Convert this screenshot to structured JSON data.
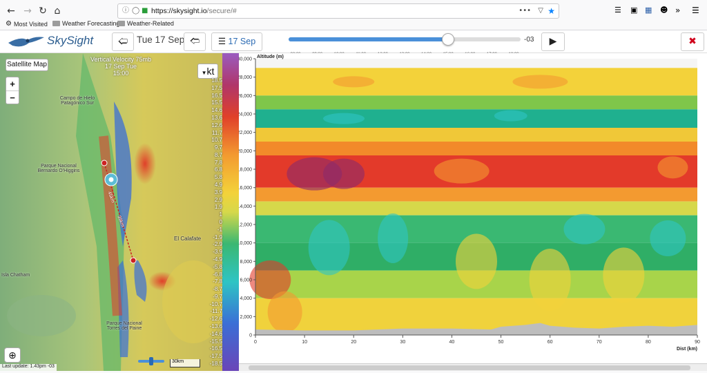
{
  "browser": {
    "url_host": "https://skysight.io",
    "url_path": "/secure/#",
    "bookmarks": [
      {
        "label": "Most Visited",
        "icon": "gear-icon"
      },
      {
        "label": "Weather Forecasting",
        "icon": "folder-icon"
      },
      {
        "label": "Weather-Related",
        "icon": "folder-icon"
      }
    ]
  },
  "app": {
    "logo_text": "SkySight",
    "date_label": "Tue 17 Sep",
    "calendar_label": "17 Sep",
    "timezone": "-03",
    "time_ticks": [
      "08:00",
      "09:00",
      "10:00",
      "11:00",
      "12:00",
      "13:00",
      "14:00",
      "15:00",
      "16:00",
      "17:00",
      "18:00"
    ],
    "selected_time_index": 7,
    "close_color": "#d0021b"
  },
  "map": {
    "satellite_button": "Satellite Map",
    "zoom_in": "+",
    "zoom_out": "−",
    "unit_button": "kt",
    "title_lines": [
      "Vertical Velocity 75mb",
      "17 Sep Tue",
      "15:00"
    ],
    "labels": [
      {
        "text": "Campo de Hielo Patagónico Sur"
      },
      {
        "text": "Parque Nacional Bernardo O'Higgins"
      },
      {
        "text": "El Calafate"
      },
      {
        "text": "Isla Chatham"
      },
      {
        "text": "Parque Nacional Torres del Paine"
      }
    ],
    "route_labels": [
      "45km",
      "39km"
    ],
    "scale_label": "30km",
    "last_update": "Last update: 1.43pm -03",
    "legend_values": [
      "18.5",
      "17.5",
      "16.5",
      "15.5",
      "14.6",
      "13.6",
      "12.6",
      "11.7",
      "10.7",
      "9.7",
      "8.7",
      "7.8",
      "6.8",
      "5.8",
      "4.9",
      "3.9",
      "2.9",
      "1.9",
      "1",
      "0",
      "-1",
      "-1.9",
      "-2.9",
      "-3.9",
      "-4.9",
      "-5.8",
      "-6.8",
      "-7.8",
      "-8.7",
      "-9.7",
      "-10.7",
      "-11.7",
      "-12.6",
      "-13.6",
      "-14.6",
      "-15.5",
      "-16.5",
      "-17.5",
      "-18.5"
    ]
  },
  "chart_data": {
    "type": "heatmap",
    "title": "",
    "xlabel": "Dist (km)",
    "ylabel": "Altitude (m)",
    "x_ticks": [
      0,
      10,
      20,
      30,
      40,
      50,
      60,
      70,
      80,
      90
    ],
    "y_ticks": [
      0,
      2000,
      4000,
      6000,
      8000,
      10000,
      12000,
      14000,
      16000,
      18000,
      20000,
      22000,
      24000,
      26000,
      28000,
      30000
    ],
    "y_tick_labels": [
      "0",
      "2,000",
      "4,000",
      "6,000",
      "8,000",
      "10,000",
      "12,000",
      "14,000",
      "16,000",
      "18,000",
      "20,000",
      "22,000",
      "24,000",
      "26,000",
      "28,000",
      "30,000"
    ],
    "xlim": [
      0,
      90
    ],
    "ylim": [
      0,
      30000
    ],
    "bands": [
      {
        "alt_from": 29000,
        "alt_to": 30000,
        "color": "#f5f5f5"
      },
      {
        "alt_from": 26000,
        "alt_to": 29000,
        "color": "#f3d23a"
      },
      {
        "alt_from": 24500,
        "alt_to": 26000,
        "color": "#7fc64a"
      },
      {
        "alt_from": 22500,
        "alt_to": 24500,
        "color": "#1fb08f"
      },
      {
        "alt_from": 21000,
        "alt_to": 22500,
        "color": "#f0c838"
      },
      {
        "alt_from": 19500,
        "alt_to": 21000,
        "color": "#f28a2a"
      },
      {
        "alt_from": 16000,
        "alt_to": 19500,
        "color": "#e33a2a"
      },
      {
        "alt_from": 14500,
        "alt_to": 16000,
        "color": "#f39a30"
      },
      {
        "alt_from": 13000,
        "alt_to": 14500,
        "color": "#d6d84a"
      },
      {
        "alt_from": 10000,
        "alt_to": 13000,
        "color": "#3ab872"
      },
      {
        "alt_from": 7000,
        "alt_to": 10000,
        "color": "#2fae66"
      },
      {
        "alt_from": 4000,
        "alt_to": 7000,
        "color": "#a8d44a"
      },
      {
        "alt_from": 0,
        "alt_to": 4000,
        "color": "#f0d23c"
      }
    ],
    "terrain_color": "#bdbdbd"
  }
}
